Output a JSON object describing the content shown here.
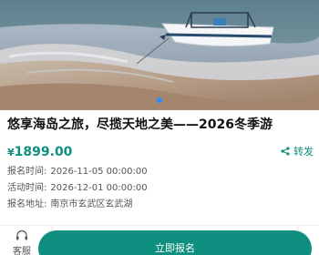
{
  "banner": {
    "slide_count": 1,
    "active_slide": 1
  },
  "event": {
    "title": "悠享海岛之旅，尽揽天地之美——2026冬季游",
    "price_symbol": "¥",
    "price_value": "1899.00",
    "share_label": "转发"
  },
  "details": [
    {
      "label": "报名时间:",
      "value": "2026-11-05 00:00:00"
    },
    {
      "label": "活动时间:",
      "value": "2026-12-01 00:00:00"
    },
    {
      "label": "报名地址:",
      "value": "南京市玄武区玄武湖"
    }
  ],
  "bottom_bar": {
    "service_label": "客服",
    "signup_label": "立即报名"
  },
  "colors": {
    "accent": "#0f8f7f",
    "indicator": "#2b8cff"
  },
  "icons": {
    "share": "share-icon",
    "service": "headset-icon"
  }
}
